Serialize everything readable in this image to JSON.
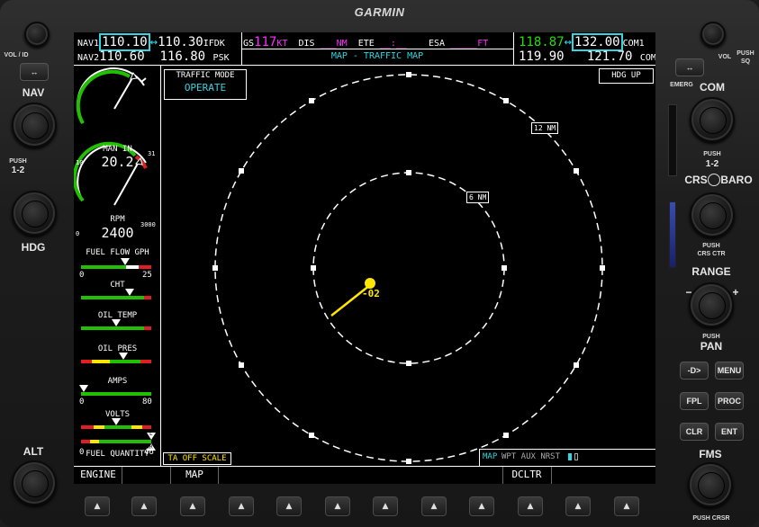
{
  "brand": "GARMIN",
  "bezel_left": {
    "vol_label": "VOL / ID",
    "nav_label": "NAV",
    "push_12_label": "PUSH",
    "push_12_value": "1-2",
    "hdg_label": "HDG",
    "alt_label": "ALT",
    "swap_icon": "↔"
  },
  "bezel_right": {
    "vol_label": "VOL",
    "push_sq_label": "PUSH",
    "sq_label": "SQ",
    "emerg_label": "EMERG",
    "com_label": "COM",
    "push_12_label": "PUSH",
    "push_12_value": "1-2",
    "crs_baro_label": "CRS",
    "crs_baro_label2": "BARO",
    "push_crs_ctr_label": "PUSH",
    "push_crs_ctr_label2": "CRS CTR",
    "range_label": "RANGE",
    "push_pan_label": "PUSH",
    "pan_label": "PAN",
    "direct_to": "-D>",
    "menu": "MENU",
    "fpl": "FPL",
    "proc": "PROC",
    "clr": "CLR",
    "ent": "ENT",
    "fms_label": "FMS",
    "push_crsr_label": "PUSH CRSR",
    "swap_icon": "↔"
  },
  "top_bar": {
    "nav1_label": "NAV1",
    "nav1_active": "110.10",
    "nav1_standby": "110.30",
    "nav1_ident": "IFDK",
    "nav2_label": "NAV2",
    "nav2_active": "110.60",
    "nav2_standby": "116.80",
    "nav2_ident": "PSK",
    "gs_label": "GS",
    "gs_value": "117",
    "gs_unit": "KT",
    "dis_label": "DIS",
    "dis_value": "___",
    "dis_unit": "NM",
    "ete_label": "ETE",
    "ete_value": "__:__",
    "esa_label": "ESA",
    "esa_value": "_____",
    "esa_unit": "FT",
    "page_title": "MAP - TRAFFIC MAP",
    "com1_active": "118.87",
    "com1_standby": "132.00",
    "com1_label": "COM1",
    "com2_active": "119.90",
    "com2_standby": "121.70",
    "com2_label": "COM2",
    "swap_icon": "↔"
  },
  "eis": {
    "man_in_label": "MAN IN",
    "man_in_value": "20.2",
    "man_in_min": "10",
    "man_in_max": "31",
    "rpm_label": "RPM",
    "rpm_value": "2400",
    "rpm_min": "0",
    "rpm_max": "3000",
    "fuel_flow_label": "FUEL FLOW GPH",
    "fuel_flow_min": "0",
    "fuel_flow_max": "25",
    "cht_label": "CHT",
    "oil_temp_label": "OIL TEMP",
    "oil_pres_label": "OIL PRES",
    "amps_label": "AMPS",
    "amps_min": "0",
    "amps_max": "80",
    "volts_label": "VOLTS",
    "fuel_qty_label": "FUEL QUANTITY",
    "fuel_qty_min": "0",
    "fuel_qty_max": "46",
    "fuel_left_marker": "L",
    "fuel_right_marker": "R"
  },
  "map": {
    "traffic_mode_label": "TRAFFIC MODE",
    "traffic_mode_value": "OPERATE",
    "orientation": "HDG UP",
    "outer_ring_label": "12 NM",
    "inner_ring_label": "6 NM",
    "traffic_altitude": "-02",
    "ta_off_scale": "TA OFF SCALE",
    "page_group_active": "MAP",
    "page_group_others": "WPT AUX NRST",
    "traffic_color": "#ffe600"
  },
  "softkeys": [
    "ENGINE",
    "",
    "MAP",
    "",
    "",
    "",
    "",
    "",
    "DCLTR",
    "",
    "",
    ""
  ]
}
